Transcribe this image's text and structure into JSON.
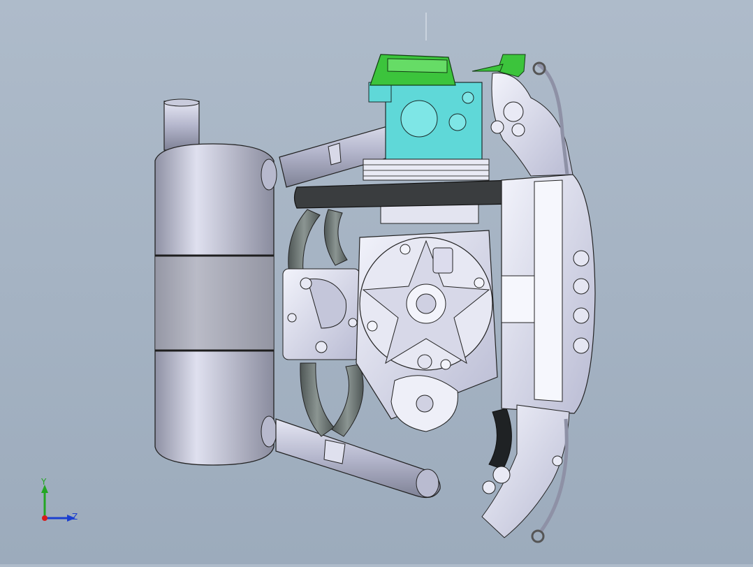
{
  "viewport": {
    "background_top": "#aebbca",
    "background_bottom": "#9cabbc"
  },
  "model": {
    "colors": {
      "metal": "#c8cbe2",
      "metal_dark": "#8c8fa6",
      "muffler": "#a9abbc",
      "hose": "#6e7775",
      "valve_cover": "#3cc43c",
      "cylinder_head": "#5fd8d8",
      "edges": "#20232b"
    }
  },
  "triad": {
    "y_label": "Y",
    "z_label": "Z",
    "x_color": "#d81b1b",
    "y_color": "#23a623",
    "z_color": "#1b3fd0"
  }
}
